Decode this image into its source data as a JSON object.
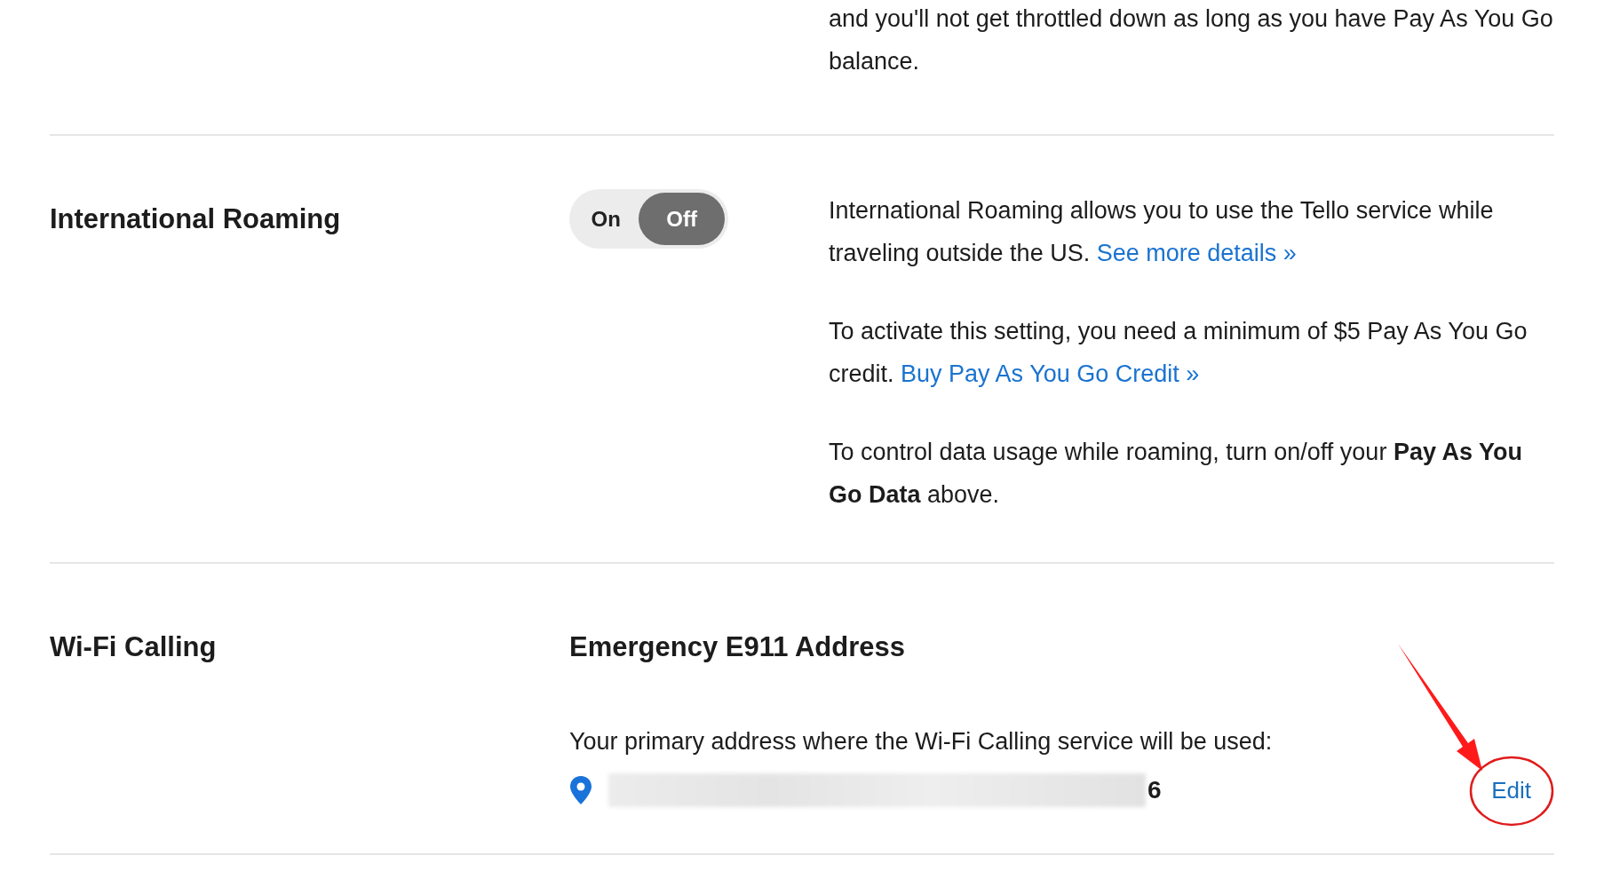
{
  "intro_text": "and you'll not get throttled down as long as you have Pay As You Go balance.",
  "sections": [
    {
      "kind": "toggle",
      "title": "International Roaming",
      "options": [
        {
          "label": "On",
          "selected": false
        },
        {
          "label": "Off",
          "selected": true
        }
      ],
      "paragraphs": [
        {
          "text": "International Roaming allows you to use the Tello service while traveling outside the US.",
          "link": "See more details »"
        },
        {
          "text": "To activate this setting, you need a minimum of $5 Pay As You Go credit.",
          "link": "Buy Pay As You Go Credit »"
        },
        {
          "text": "To control data usage while roaming, turn on/off your **Pay As You Go Data** above."
        }
      ]
    },
    {
      "kind": "address",
      "title": "Wi-Fi Calling",
      "heading": "Emergency E911 Address",
      "prompt": "Your primary address where the Wi-Fi Calling service will be used:",
      "address_end": "6",
      "edit": "Edit"
    }
  ]
}
